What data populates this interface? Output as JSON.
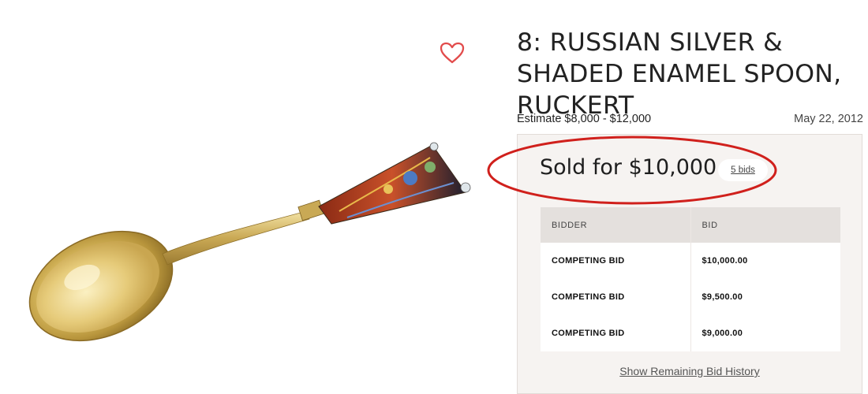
{
  "lot": {
    "title": "8: RUSSIAN SILVER & SHADED ENAMEL SPOON, RUCKERT",
    "estimate": "Estimate $8,000 - $12,000",
    "date": "May 22, 2012"
  },
  "result": {
    "sold_label": "Sold for $10,000",
    "bids_count": "5 bids"
  },
  "bid_table": {
    "headers": [
      "BIDDER",
      "BID"
    ],
    "rows": [
      {
        "bidder": "COMPETING BID",
        "bid": "$10,000.00"
      },
      {
        "bidder": "COMPETING BID",
        "bid": "$9,500.00"
      },
      {
        "bidder": "COMPETING BID",
        "bid": "$9,000.00"
      }
    ]
  },
  "show_history": "Show Remaining Bid History",
  "icons": {
    "favorite": "heart-outline-icon",
    "image": "lot-image"
  },
  "colors": {
    "favorite_red": "#e24b4b",
    "annotation_red": "#d0201c",
    "panel_bg": "#f6f3f1"
  }
}
